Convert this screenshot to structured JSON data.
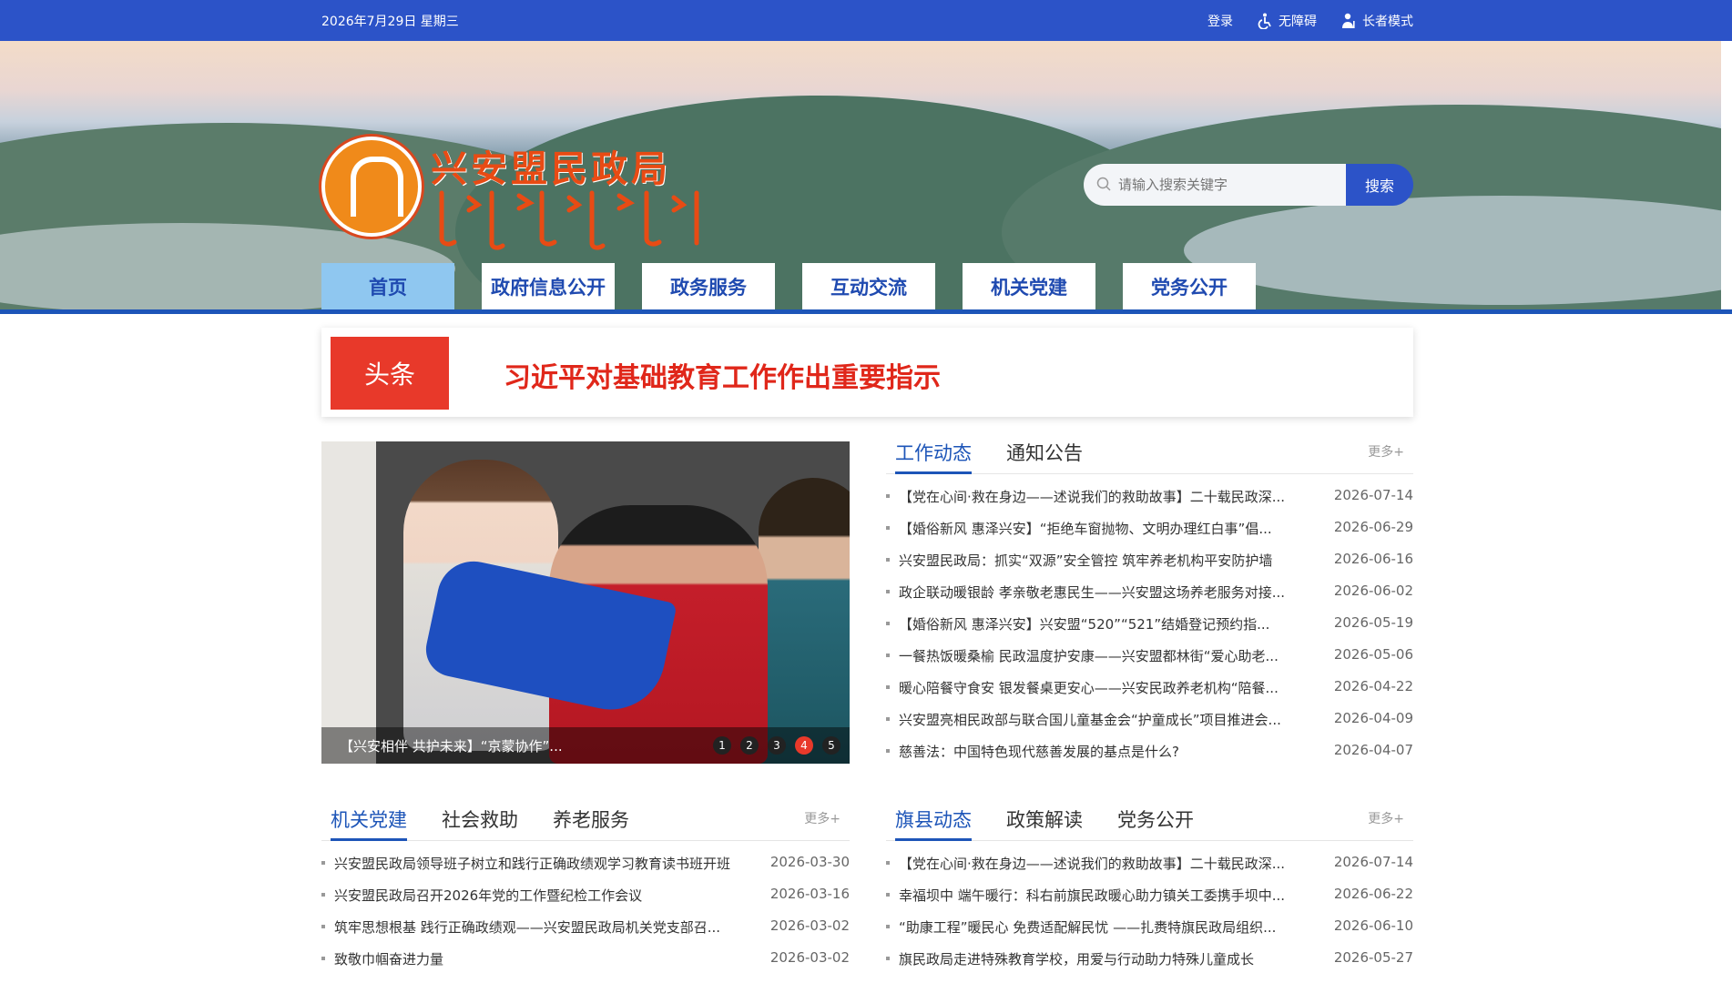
{
  "topbar": {
    "date": "2026年7月29日 星期三",
    "login": "登录",
    "accessible": "无障碍",
    "elder": "长者模式"
  },
  "header": {
    "title": "兴安盟民政局"
  },
  "search": {
    "placeholder": "请输入搜索关键字",
    "button": "搜索"
  },
  "nav": [
    {
      "label": "首页",
      "active": true
    },
    {
      "label": "政府信息公开"
    },
    {
      "label": "政务服务"
    },
    {
      "label": "互动交流"
    },
    {
      "label": "机关党建"
    },
    {
      "label": "党务公开"
    }
  ],
  "headline": {
    "tag": "头条",
    "text": "习近平对基础教育工作作出重要指示"
  },
  "slider": {
    "caption": "【兴安相伴 共护未来】“京蒙协作”...",
    "dots": [
      "1",
      "2",
      "3",
      "4",
      "5"
    ],
    "active_dot": 4
  },
  "panel_work": {
    "tabs": [
      "工作动态",
      "通知公告"
    ],
    "more": "更多+",
    "items": [
      {
        "title": "【党在心间·救在身边——述说我们的救助故事】二十载民政深...",
        "date": "2026-07-14"
      },
      {
        "title": "【婚俗新风 惠泽兴安】“拒绝车窗抛物、文明办理红白事”倡...",
        "date": "2026-06-29"
      },
      {
        "title": "兴安盟民政局：抓实“双源”安全管控 筑牢养老机构平安防护墙",
        "date": "2026-06-16"
      },
      {
        "title": "政企联动暖银龄 孝亲敬老惠民生——兴安盟这场养老服务对接...",
        "date": "2026-06-02"
      },
      {
        "title": "【婚俗新风 惠泽兴安】兴安盟“520”“521”结婚登记预约指...",
        "date": "2026-05-19"
      },
      {
        "title": "一餐热饭暖桑榆 民政温度护安康——兴安盟都林街“爱心助老...",
        "date": "2026-05-06"
      },
      {
        "title": "暖心陪餐守食安 银发餐桌更安心——兴安民政养老机构“陪餐...",
        "date": "2026-04-22"
      },
      {
        "title": "兴安盟亮相民政部与联合国儿童基金会“护童成长”项目推进会...",
        "date": "2026-04-09"
      },
      {
        "title": "慈善法：中国特色现代慈善发展的基点是什么?",
        "date": "2026-04-07"
      }
    ]
  },
  "panel_party": {
    "tabs": [
      "机关党建",
      "社会救助",
      "养老服务"
    ],
    "more": "更多+",
    "items": [
      {
        "title": "兴安盟民政局领导班子树立和践行正确政绩观学习教育读书班开班",
        "date": "2026-03-30"
      },
      {
        "title": "兴安盟民政局召开2026年党的工作暨纪检工作会议",
        "date": "2026-03-16"
      },
      {
        "title": "筑牢思想根基 践行正确政绩观——兴安盟民政局机关党支部召...",
        "date": "2026-03-02"
      },
      {
        "title": "致敬巾帼奋进力量",
        "date": "2026-03-02"
      }
    ]
  },
  "panel_county": {
    "tabs": [
      "旗县动态",
      "政策解读",
      "党务公开"
    ],
    "more": "更多+",
    "items": [
      {
        "title": "【党在心间·救在身边——述说我们的救助故事】二十载民政深...",
        "date": "2026-07-14"
      },
      {
        "title": "幸福坝中 端午暖行：科右前旗民政暖心助力镇关工委携手坝中...",
        "date": "2026-06-22"
      },
      {
        "title": "“助康工程”暖民心 免费适配解民忧 ——扎赉特旗民政局组织...",
        "date": "2026-06-10"
      },
      {
        "title": "旗民政局走进特殊教育学校，用爱与行动助力特殊儿童成长",
        "date": "2026-05-27"
      }
    ]
  }
}
